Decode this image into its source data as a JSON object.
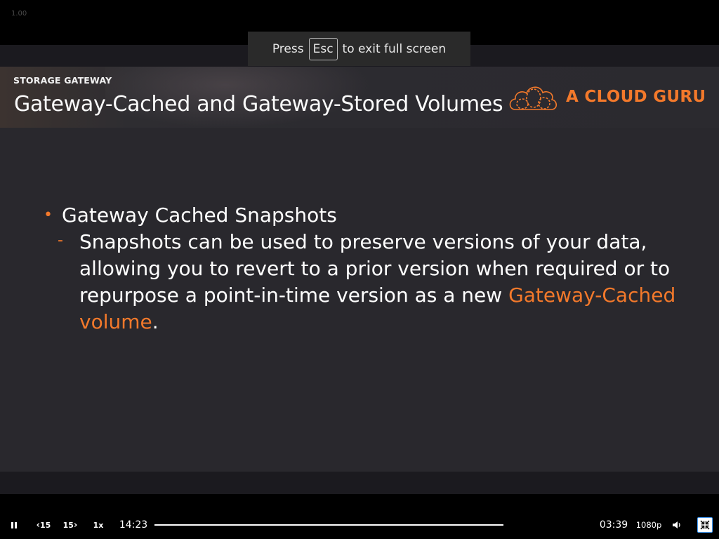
{
  "overlay": {
    "debug_value": "1.00"
  },
  "fullscreen_toast": {
    "press": "Press",
    "key": "Esc",
    "suffix": "to exit full screen"
  },
  "slide": {
    "kicker": "STORAGE GATEWAY",
    "title": "Gateway-Cached and Gateway-Stored Volumes",
    "logo_text": "A CLOUD GURU",
    "bullet": "Gateway Cached Snapshots",
    "sub_bullet_text": "Snapshots can be used to preserve versions of your data, allowing you to revert to a prior version when required or to repurpose a point-in-time version as a new",
    "sub_bullet_highlight": "Gateway-Cached volume",
    "sub_bullet_end": ".",
    "accent_color": "#f3792b"
  },
  "player": {
    "play_state_icon": "pause-icon",
    "rewind_label": "15",
    "forward_label": "15",
    "speed": "1x",
    "elapsed": "14:23",
    "remaining": "03:39",
    "progress": 1.0,
    "quality": "1080p",
    "volume_icon": "volume-icon",
    "fullscreen_icon": "exit-fullscreen-icon"
  }
}
